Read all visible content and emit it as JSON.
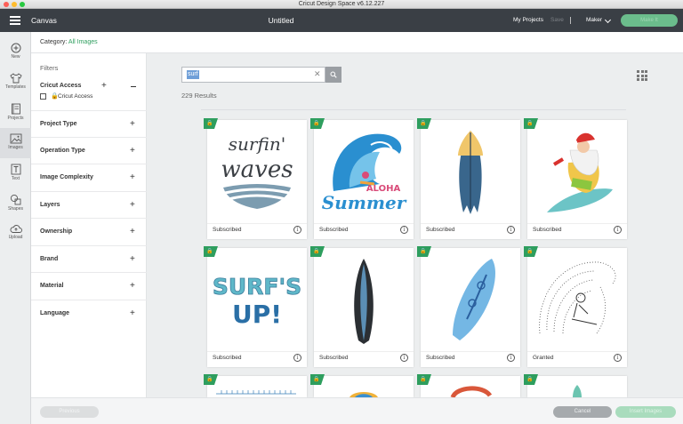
{
  "window": {
    "title": "Cricut Design Space  v6.12.227"
  },
  "header": {
    "canvas_label": "Canvas",
    "document_title": "Untitled",
    "my_projects": "My Projects",
    "save": "Save",
    "machine": "Maker",
    "make_it": "Make It"
  },
  "rail": {
    "items": [
      {
        "label": "New",
        "icon": "plus-circle-icon"
      },
      {
        "label": "Templates",
        "icon": "shirt-icon"
      },
      {
        "label": "Projects",
        "icon": "projects-icon"
      },
      {
        "label": "Images",
        "icon": "images-icon",
        "active": true
      },
      {
        "label": "Text",
        "icon": "text-icon"
      },
      {
        "label": "Shapes",
        "icon": "shapes-icon"
      },
      {
        "label": "Upload",
        "icon": "upload-cloud-icon"
      }
    ]
  },
  "category": {
    "label": "Category:",
    "value": "All Images"
  },
  "filters": {
    "title": "Filters",
    "cricut_access": {
      "label": "Cricut Access",
      "option": "Cricut Access"
    },
    "sections": [
      "Project Type",
      "Operation Type",
      "Image Complexity",
      "Layers",
      "Ownership",
      "Brand",
      "Material",
      "Language"
    ]
  },
  "search": {
    "value": "surf",
    "results": "229 Results"
  },
  "cards": [
    {
      "status": "Subscribed",
      "art": "surfin-waves"
    },
    {
      "status": "Subscribed",
      "art": "aloha-summer"
    },
    {
      "status": "Subscribed",
      "art": "surfboard-blue-yellow"
    },
    {
      "status": "Subscribed",
      "art": "santa-surfing"
    },
    {
      "status": "Subscribed",
      "art": "surfs-up"
    },
    {
      "status": "Subscribed",
      "art": "surfboard-black-blue"
    },
    {
      "status": "Subscribed",
      "art": "surfboard-light-blue"
    },
    {
      "status": "Granted",
      "art": "surfer-wave-sketch"
    }
  ],
  "footer": {
    "previous": "Previous",
    "cancel": "Cancel",
    "insert": "Insert Images"
  },
  "colors": {
    "header": "#3a3f45",
    "accent": "#2e9e5e",
    "wave_blue": "#2a8fd0"
  }
}
